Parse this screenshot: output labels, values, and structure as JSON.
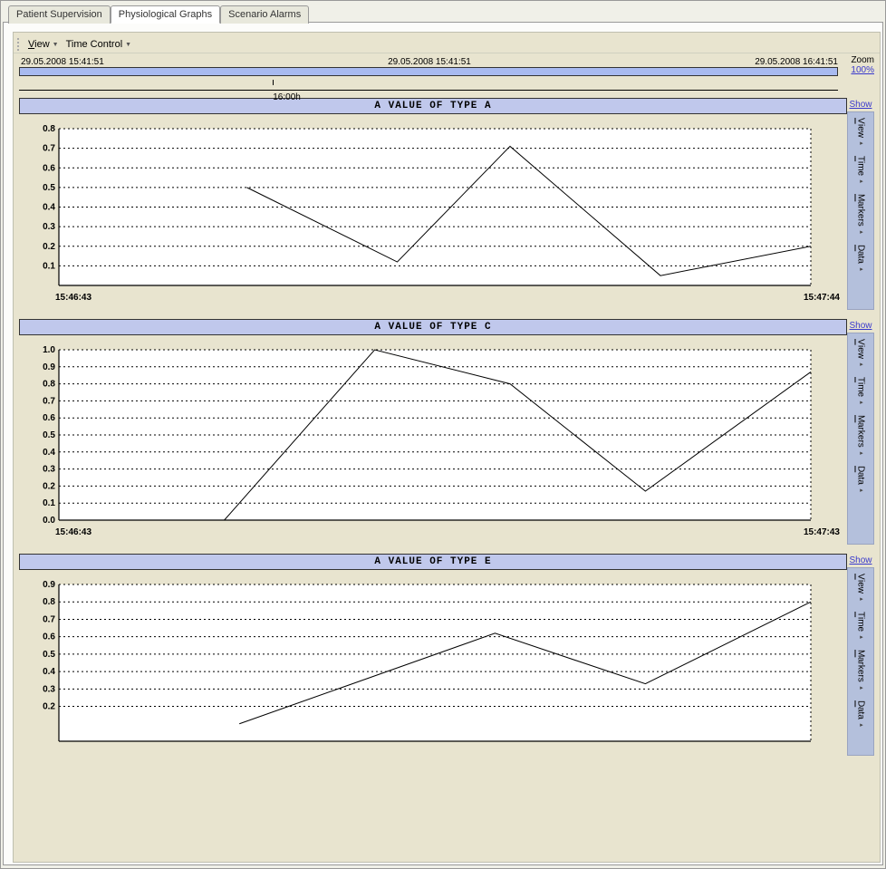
{
  "tabs": {
    "patient": "Patient Supervision",
    "physio": "Physiological Graphs",
    "alarms": "Scenario Alarms"
  },
  "toolbar": {
    "view": "View",
    "time_control": "Time Control"
  },
  "timeline": {
    "start": "29.05.2008 15:41:51",
    "mid": "29.05.2008 15:41:51",
    "end": "29.05.2008 16:41:51",
    "zoom_label": "Zoom",
    "zoom_value": "100%",
    "tick": "16:00h"
  },
  "sidebar": {
    "show": "Show",
    "view": "View",
    "time": "Time",
    "markers": "Markers",
    "data": "Data"
  },
  "chart_data": [
    {
      "type": "line",
      "title": "A VALUE OF TYPE A",
      "ylim": [
        0,
        0.8
      ],
      "yticks": [
        "0.1",
        "0.2",
        "0.3",
        "0.4",
        "0.5",
        "0.6",
        "0.7",
        "0.8"
      ],
      "x_start": "15:46:43",
      "x_end": "15:47:44",
      "series": [
        {
          "name": "A",
          "x": [
            0.25,
            0.45,
            0.6,
            0.8,
            1.0
          ],
          "y": [
            0.5,
            0.12,
            0.71,
            0.05,
            0.2
          ]
        }
      ]
    },
    {
      "type": "line",
      "title": "A VALUE OF TYPE C",
      "ylim": [
        0,
        1.0
      ],
      "yticks": [
        "0.0",
        "0.1",
        "0.2",
        "0.3",
        "0.4",
        "0.5",
        "0.6",
        "0.7",
        "0.8",
        "0.9",
        "1.0"
      ],
      "x_start": "15:46:43",
      "x_end": "15:47:43",
      "series": [
        {
          "name": "C",
          "x": [
            0.22,
            0.42,
            0.6,
            0.78,
            1.0
          ],
          "y": [
            0.0,
            1.0,
            0.8,
            0.17,
            0.87
          ]
        }
      ]
    },
    {
      "type": "line",
      "title": "A VALUE OF TYPE E",
      "ylim": [
        0,
        0.9
      ],
      "yticks": [
        "0.2",
        "0.3",
        "0.4",
        "0.5",
        "0.6",
        "0.7",
        "0.8",
        "0.9"
      ],
      "x_start": "",
      "x_end": "",
      "series": [
        {
          "name": "E",
          "x": [
            0.24,
            0.58,
            0.78,
            1.0
          ],
          "y": [
            0.1,
            0.62,
            0.33,
            0.8
          ]
        }
      ]
    }
  ]
}
